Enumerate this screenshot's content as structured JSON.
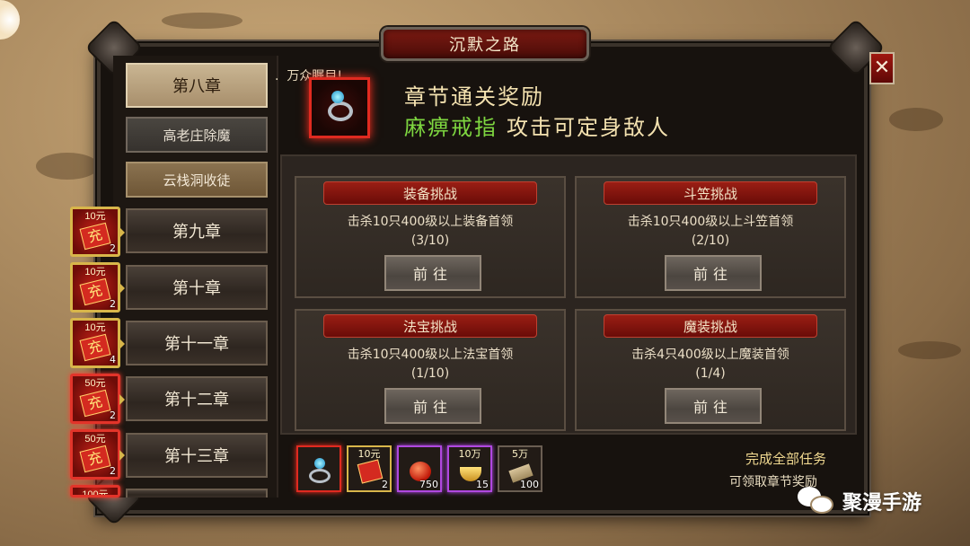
{
  "window": {
    "title": "沉默之路",
    "close_label": "✕"
  },
  "sidebar": {
    "chapters": [
      {
        "label": "第八章",
        "active": true
      },
      {
        "label": "第九章",
        "active": false
      },
      {
        "label": "第十章",
        "active": false
      },
      {
        "label": "第十一章",
        "active": false
      },
      {
        "label": "第十二章",
        "active": false
      },
      {
        "label": "第十三章",
        "active": false
      }
    ],
    "subtasks": [
      {
        "label": "高老庄除魔"
      },
      {
        "label": "云栈洞收徒"
      }
    ]
  },
  "recharge_badges": [
    {
      "amount": "10元",
      "glyph": "充",
      "count": "2"
    },
    {
      "amount": "10元",
      "glyph": "充",
      "count": "2"
    },
    {
      "amount": "10元",
      "glyph": "充",
      "count": "4"
    },
    {
      "amount": "50元",
      "glyph": "充",
      "count": "2"
    },
    {
      "amount": "50元",
      "glyph": "充",
      "count": "2"
    },
    {
      "amount": "100元",
      "glyph": "",
      "count": ""
    }
  ],
  "announcement": "万众瞩目!",
  "chapter_reward": {
    "title": "章节通关奖励",
    "item_name": "麻痹戒指",
    "effect": "攻击可定身敌人"
  },
  "tasks": [
    {
      "title": "装备挑战",
      "desc": "击杀10只400级以上装备首领",
      "progress": "(3/10)",
      "button": "前往"
    },
    {
      "title": "斗笠挑战",
      "desc": "击杀10只400级以上斗笠首领",
      "progress": "(2/10)",
      "button": "前往"
    },
    {
      "title": "法宝挑战",
      "desc": "击杀10只400级以上法宝首领",
      "progress": "(1/10)",
      "button": "前往"
    },
    {
      "title": "魔装挑战",
      "desc": "击杀4只400级以上魔装首领",
      "progress": "(1/4)",
      "button": "前往"
    }
  ],
  "reward_items": [
    {
      "icon": "ring-icon",
      "top": "",
      "count": ""
    },
    {
      "icon": "recharge-card-icon",
      "top": "10元",
      "count": "2"
    },
    {
      "icon": "red-fruit-icon",
      "top": "",
      "count": "750"
    },
    {
      "icon": "gold-ingot-icon",
      "top": "10万",
      "count": "15"
    },
    {
      "icon": "scroll-icon",
      "top": "5万",
      "count": "100"
    }
  ],
  "complete": {
    "line1": "完成全部任务",
    "line2": "可领取章节奖励"
  },
  "watermark": "聚漫手游"
}
